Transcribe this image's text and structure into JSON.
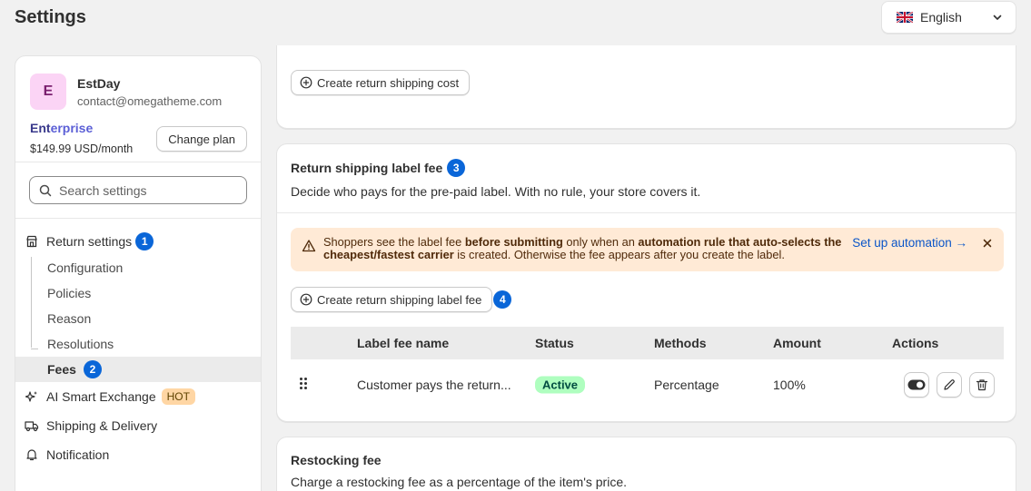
{
  "page": {
    "title": "Settings"
  },
  "language": {
    "flag_icon": "uk-flag-icon",
    "label": "English"
  },
  "store": {
    "avatar_letter": "E",
    "name": "EstDay",
    "email": "contact@omegatheme.com",
    "plan_part1": "Ent",
    "plan_part2": "erprise",
    "plan_price": "$149.99 USD/month",
    "change_plan_label": "Change plan"
  },
  "search": {
    "placeholder": "Search settings"
  },
  "sidebar": {
    "return_settings": {
      "label": "Return settings",
      "badge": "1"
    },
    "sub_items": [
      {
        "label": "Configuration"
      },
      {
        "label": "Policies"
      },
      {
        "label": "Reason"
      },
      {
        "label": "Resolutions"
      },
      {
        "label": "Fees",
        "badge": "2"
      }
    ],
    "ai_exchange": {
      "label": "AI Smart Exchange",
      "tag": "HOT"
    },
    "shipping": {
      "label": "Shipping & Delivery"
    },
    "notification": {
      "label": "Notification"
    }
  },
  "shipping_cost": {
    "create_label": "Create return shipping cost"
  },
  "label_fee": {
    "title": "Return shipping label fee",
    "badge": "3",
    "description": "Decide who pays for the pre-paid label. With no rule, your store covers it.",
    "banner": {
      "text_1": "Shoppers see the label fee ",
      "bold_1": "before submitting",
      "text_2": " only when an ",
      "bold_2": "automation rule that auto-selects the cheapest/fastest carrier",
      "text_3": " is created. Otherwise the fee appears after you create the label.",
      "link": "Set up automation →"
    },
    "create_label": "Create return shipping label fee",
    "create_badge": "4",
    "columns": {
      "name": "Label fee name",
      "status": "Status",
      "methods": "Methods",
      "amount": "Amount",
      "actions": "Actions"
    },
    "rows": [
      {
        "name": "Customer pays the return...",
        "status": "Active",
        "method": "Percentage",
        "amount": "100%"
      }
    ]
  },
  "restocking": {
    "title": "Restocking fee",
    "description": "Charge a restocking fee as a percentage of the item's price."
  },
  "colors": {
    "badge_blue": "#0a66d8",
    "active_green": "#affebf",
    "banner_bg": "#ffead6",
    "link_blue": "#0a55c8"
  }
}
